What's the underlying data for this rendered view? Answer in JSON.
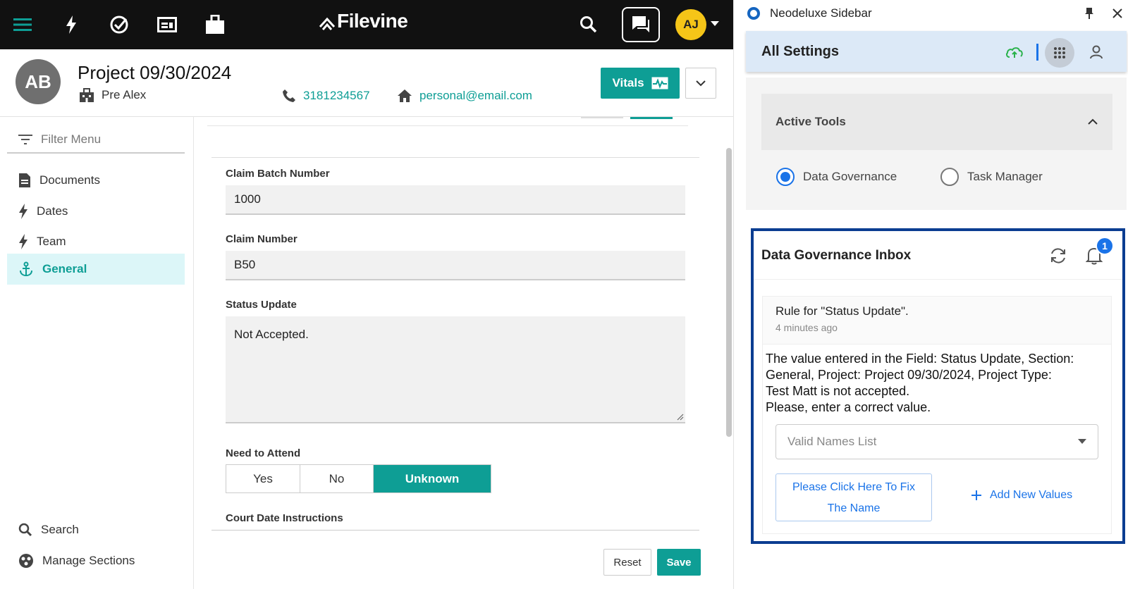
{
  "topbar": {
    "logo": "Filevine",
    "user_initials": "AJ"
  },
  "project": {
    "avatar_initials": "AB",
    "title": "Project 09/30/2024",
    "client": "Pre Alex",
    "phone": "3181234567",
    "email": "personal@email.com",
    "vitals_label": "Vitals"
  },
  "sidebar": {
    "filter_placeholder": "Filter Menu",
    "items": [
      {
        "label": "Documents",
        "icon": "document-icon"
      },
      {
        "label": "Dates",
        "icon": "bolt-icon"
      },
      {
        "label": "Team",
        "icon": "bolt-icon"
      },
      {
        "label": "General",
        "icon": "anchor-icon",
        "active": true
      }
    ],
    "bottom": [
      {
        "label": "Search",
        "icon": "search-icon"
      },
      {
        "label": "Manage Sections",
        "icon": "sections-icon"
      }
    ]
  },
  "form": {
    "claim_batch": {
      "label": "Claim Batch Number",
      "value": "1000"
    },
    "claim_number": {
      "label": "Claim Number",
      "value": "B50"
    },
    "status_update": {
      "label": "Status Update",
      "value": "Not Accepted."
    },
    "need_to_attend": {
      "label": "Need to Attend",
      "options": [
        "Yes",
        "No",
        "Unknown"
      ],
      "selected": "Unknown"
    },
    "court_date": {
      "label": "Court Date Instructions"
    },
    "reset_label": "Reset",
    "save_label": "Save"
  },
  "panel": {
    "window_title": "Neodeluxe Sidebar",
    "settings_title": "All Settings",
    "active_tools": {
      "title": "Active Tools",
      "options": [
        "Data Governance",
        "Task Manager"
      ],
      "selected": "Data Governance"
    },
    "inbox": {
      "title": "Data Governance Inbox",
      "badge_count": "1",
      "rule_title": "Rule for \"Status Update\".",
      "rule_time": "4 minutes ago",
      "message_lines": [
        "The value entered in the Field: Status Update, Section:",
        "General, Project: Project 09/30/2024, Project Type:",
        "Test Matt is not accepted.",
        "Please, enter a correct value."
      ],
      "select_placeholder": "Valid Names List",
      "fix_label_line1": "Please Click Here To Fix",
      "fix_label_line2": "The Name",
      "add_label": "Add New Values"
    }
  },
  "colors": {
    "accent": "#0e9e95",
    "blue": "#1a73e8",
    "inbox_border": "#0b3d91",
    "avatar_yellow": "#f5c518"
  }
}
